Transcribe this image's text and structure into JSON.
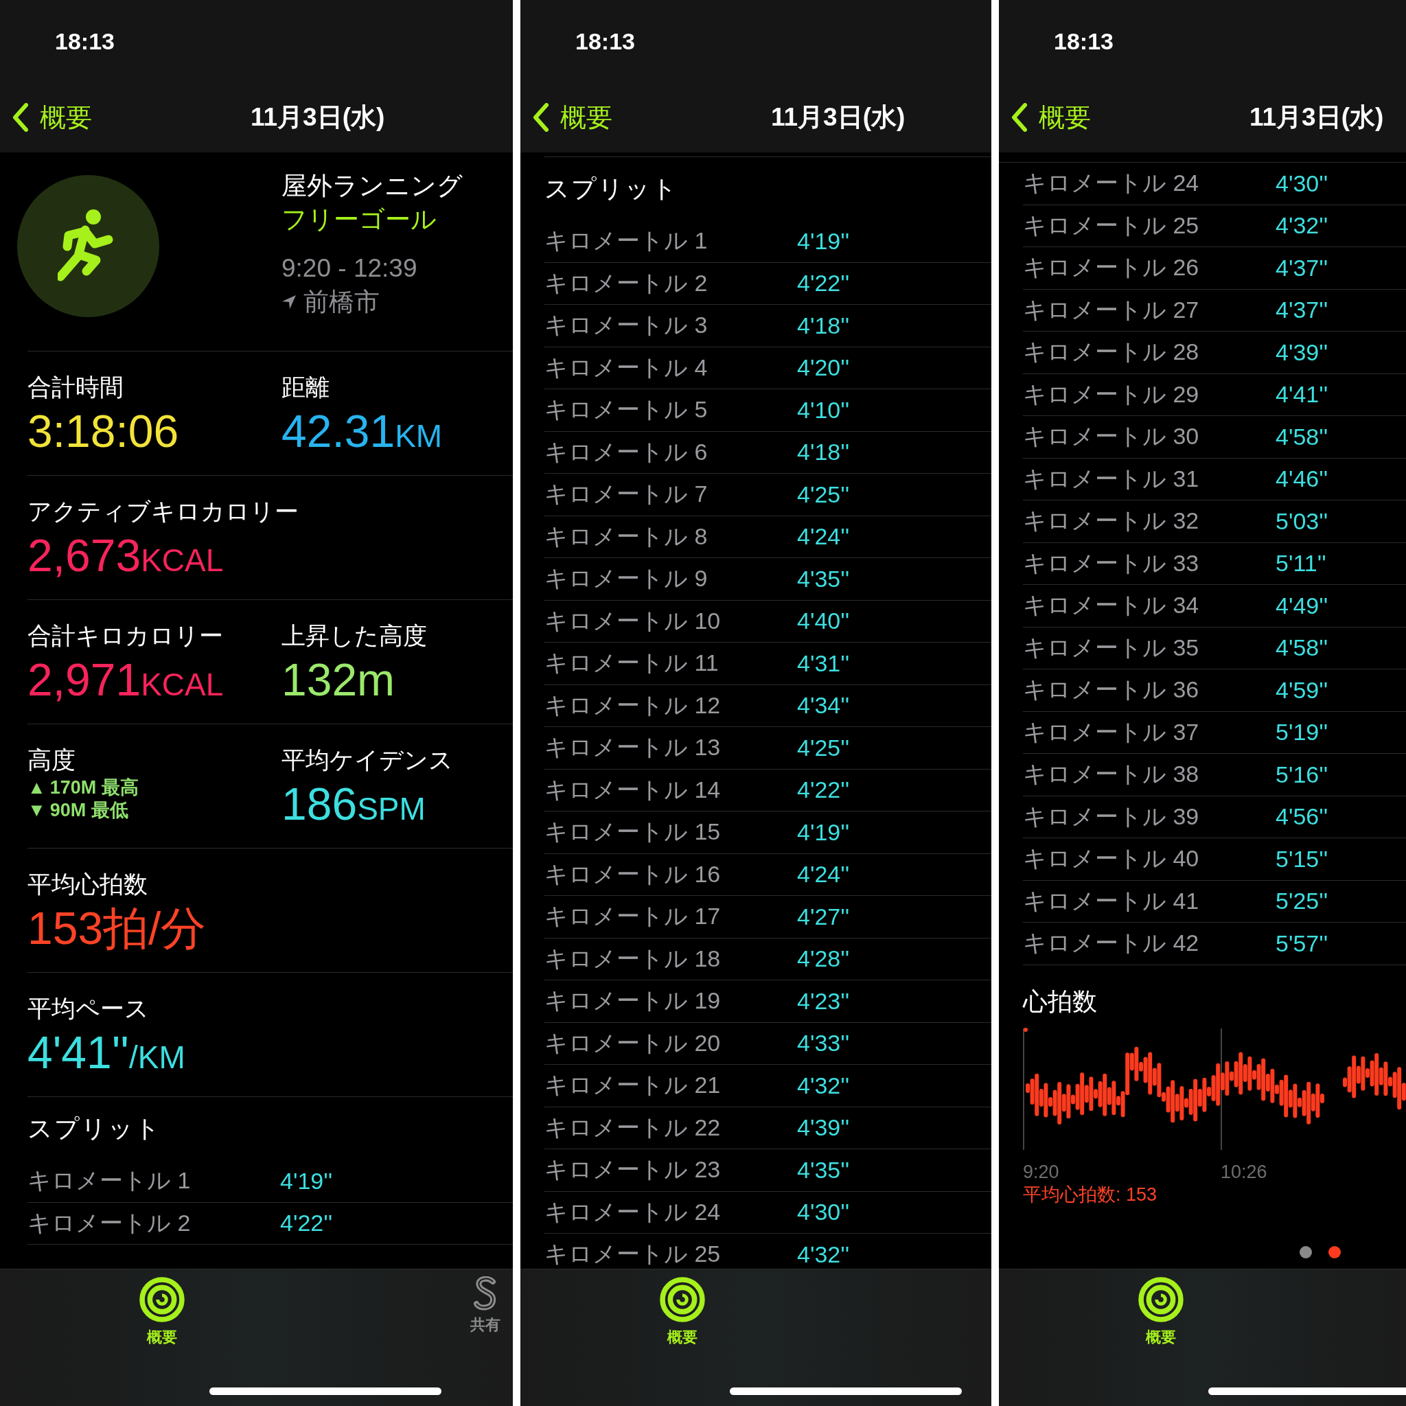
{
  "panels": [
    {
      "status_time": "18:13",
      "nav": {
        "back": "概要",
        "title": "11月3日(水)"
      },
      "workout": {
        "title": "屋外ランニング",
        "goal": "フリーゴール",
        "time": "9:20 - 12:39",
        "location": "前橋市"
      },
      "metric_rows": [
        [
          {
            "kind": "value",
            "label": "合計時間",
            "value": "3:18:06",
            "color": "#f2e33a"
          },
          {
            "kind": "value",
            "label": "距離",
            "value": "42.31",
            "unit": "KM",
            "color": "#27b4ef"
          }
        ],
        [
          {
            "kind": "value",
            "label": "アクティブキロカロリー",
            "value": "2,673",
            "unit": "KCAL",
            "color": "#f7245b"
          }
        ],
        [
          {
            "kind": "value",
            "label": "合計キロカロリー",
            "value": "2,971",
            "unit": "KCAL",
            "color": "#f7245b"
          },
          {
            "kind": "value",
            "label": "上昇した高度",
            "value": "132m",
            "color": "#9be86b"
          }
        ],
        [
          {
            "kind": "range",
            "label": "高度",
            "color": "#8fe06d",
            "lines": [
              {
                "icon": "▲",
                "text": "170M 最高"
              },
              {
                "icon": "▼",
                "text": "90M 最低"
              }
            ]
          },
          {
            "kind": "value",
            "label": "平均ケイデンス",
            "value": "186",
            "unit": "SPM",
            "color": "#3ddfe0"
          }
        ],
        [
          {
            "kind": "value",
            "label": "平均心拍数",
            "value": "153拍/分",
            "color": "#ff4326"
          }
        ],
        [
          {
            "kind": "value",
            "label": "平均ペース",
            "value": "4'41''",
            "unit": "/KM",
            "color": "#3ddfe0"
          }
        ]
      ],
      "splits": {
        "title": "スプリット",
        "rows": [
          {
            "label": "キロメートル 1",
            "pace": "4'19''"
          },
          {
            "label": "キロメートル 2",
            "pace": "4'22''"
          }
        ]
      },
      "tabs": [
        {
          "kind": "summary",
          "label": "概要",
          "selected": true
        },
        {
          "kind": "sharing",
          "label": "共有",
          "selected": false
        }
      ]
    },
    {
      "status_time": "18:13",
      "nav": {
        "back": "概要",
        "title": "11月3日(水)"
      },
      "splits": {
        "title": "スプリット",
        "rows": [
          {
            "label": "キロメートル 1",
            "pace": "4'19''"
          },
          {
            "label": "キロメートル 2",
            "pace": "4'22''"
          },
          {
            "label": "キロメートル 3",
            "pace": "4'18''"
          },
          {
            "label": "キロメートル 4",
            "pace": "4'20''"
          },
          {
            "label": "キロメートル 5",
            "pace": "4'10''"
          },
          {
            "label": "キロメートル 6",
            "pace": "4'18''"
          },
          {
            "label": "キロメートル 7",
            "pace": "4'25''"
          },
          {
            "label": "キロメートル 8",
            "pace": "4'24''"
          },
          {
            "label": "キロメートル 9",
            "pace": "4'35''"
          },
          {
            "label": "キロメートル 10",
            "pace": "4'40''"
          },
          {
            "label": "キロメートル 11",
            "pace": "4'31''"
          },
          {
            "label": "キロメートル 12",
            "pace": "4'34''"
          },
          {
            "label": "キロメートル 13",
            "pace": "4'25''"
          },
          {
            "label": "キロメートル 14",
            "pace": "4'22''"
          },
          {
            "label": "キロメートル 15",
            "pace": "4'19''"
          },
          {
            "label": "キロメートル 16",
            "pace": "4'24''"
          },
          {
            "label": "キロメートル 17",
            "pace": "4'27''"
          },
          {
            "label": "キロメートル 18",
            "pace": "4'28''"
          },
          {
            "label": "キロメートル 19",
            "pace": "4'23''"
          },
          {
            "label": "キロメートル 20",
            "pace": "4'33''"
          },
          {
            "label": "キロメートル 21",
            "pace": "4'32''"
          },
          {
            "label": "キロメートル 22",
            "pace": "4'39''"
          },
          {
            "label": "キロメートル 23",
            "pace": "4'35''"
          },
          {
            "label": "キロメートル 24",
            "pace": "4'30''"
          },
          {
            "label": "キロメートル 25",
            "pace": "4'32''"
          }
        ]
      },
      "tabs": [
        {
          "kind": "summary",
          "label": "概要",
          "selected": true
        }
      ]
    },
    {
      "status_time": "18:13",
      "nav": {
        "back": "概要",
        "title": "11月3日(水)"
      },
      "splits": {
        "rows": [
          {
            "label": "キロメートル 24",
            "pace": "4'30''"
          },
          {
            "label": "キロメートル 25",
            "pace": "4'32''"
          },
          {
            "label": "キロメートル 26",
            "pace": "4'37''"
          },
          {
            "label": "キロメートル 27",
            "pace": "4'37''"
          },
          {
            "label": "キロメートル 28",
            "pace": "4'39''"
          },
          {
            "label": "キロメートル 29",
            "pace": "4'41''"
          },
          {
            "label": "キロメートル 30",
            "pace": "4'58''"
          },
          {
            "label": "キロメートル 31",
            "pace": "4'46''"
          },
          {
            "label": "キロメートル 32",
            "pace": "5'03''"
          },
          {
            "label": "キロメートル 33",
            "pace": "5'11''"
          },
          {
            "label": "キロメートル 34",
            "pace": "4'49''"
          },
          {
            "label": "キロメートル 35",
            "pace": "4'58''"
          },
          {
            "label": "キロメートル 36",
            "pace": "4'59''"
          },
          {
            "label": "キロメートル 37",
            "pace": "5'19''"
          },
          {
            "label": "キロメートル 38",
            "pace": "5'16''"
          },
          {
            "label": "キロメートル 39",
            "pace": "4'56''"
          },
          {
            "label": "キロメートル 40",
            "pace": "5'15''"
          },
          {
            "label": "キロメートル 41",
            "pace": "5'25''"
          },
          {
            "label": "キロメートル 42",
            "pace": "5'57''"
          }
        ]
      },
      "heart_rate": {
        "title": "心拍数",
        "x_labels": [
          "9:20",
          "10:26"
        ],
        "average": "平均心拍数: 153"
      },
      "page_dots": [
        {
          "selected": false
        },
        {
          "selected": true
        }
      ],
      "tabs": [
        {
          "kind": "summary",
          "label": "概要",
          "selected": true
        }
      ]
    }
  ]
}
